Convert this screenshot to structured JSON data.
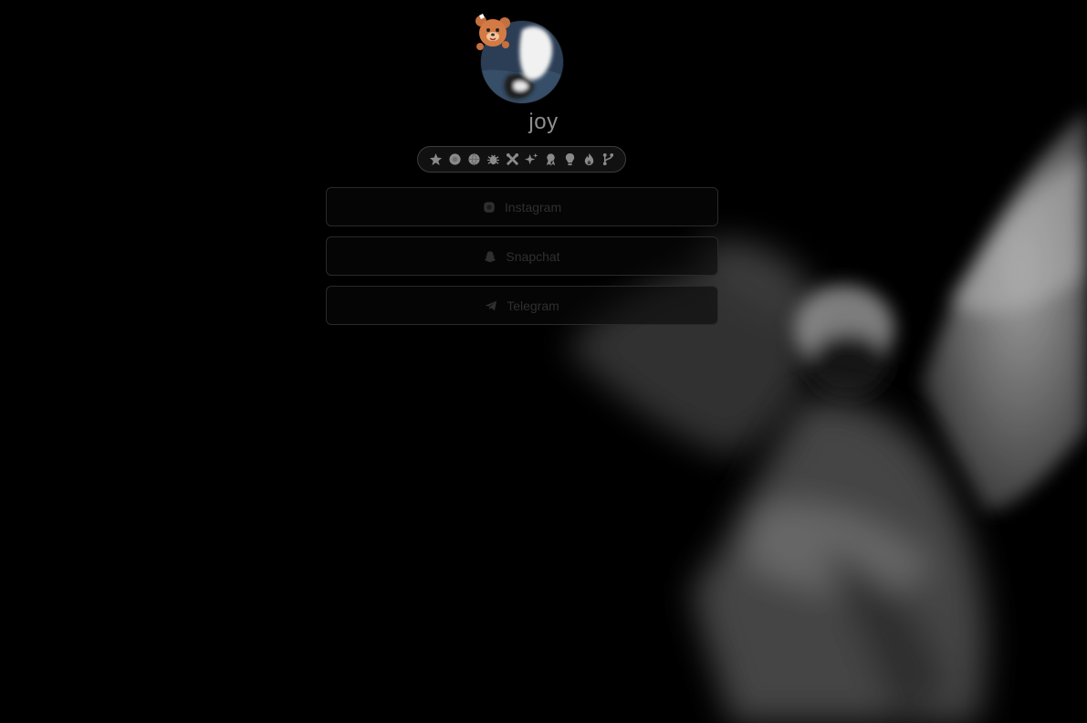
{
  "profile": {
    "username": "joy"
  },
  "badges": [
    {
      "icon": "star-icon"
    },
    {
      "icon": "circle-icon"
    },
    {
      "icon": "globe-icon"
    },
    {
      "icon": "bug-icon"
    },
    {
      "icon": "tools-icon"
    },
    {
      "icon": "sparkle-icon"
    },
    {
      "icon": "ribbon-icon"
    },
    {
      "icon": "bulb-icon"
    },
    {
      "icon": "flame-icon"
    },
    {
      "icon": "branch-icon"
    }
  ],
  "links": [
    {
      "label": "Instagram",
      "icon": "instagram-icon"
    },
    {
      "label": "Snapchat",
      "icon": "snapchat-icon"
    },
    {
      "label": "Telegram",
      "icon": "telegram-icon"
    }
  ],
  "colors": {
    "background": "#000000",
    "username": "#8e8e8e",
    "badge_icon": "#8a8a8a",
    "link_text": "#2f2f2f",
    "link_border": "#2a2a2a"
  }
}
